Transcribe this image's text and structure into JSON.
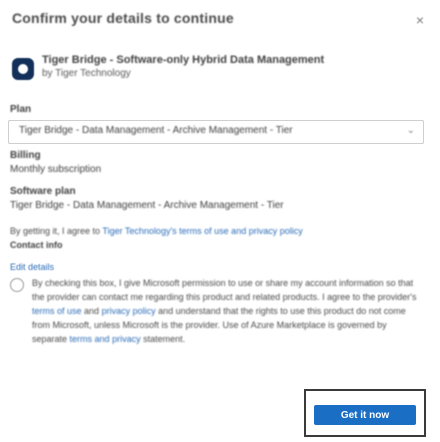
{
  "dialog": {
    "title": "Confirm your details to continue",
    "close_glyph": "×"
  },
  "product": {
    "icon": "app-logo-icon",
    "name": "Tiger Bridge - Software-only Hybrid Data Management",
    "description": "by Tiger Technology"
  },
  "plan": {
    "label": "Plan",
    "selected": "Tiger Bridge - Data Management - Archive Management - Tier"
  },
  "billing": {
    "label": "Billing",
    "value": "Monthly subscription"
  },
  "software_plan": {
    "label": "Software plan",
    "value": "Tiger Bridge - Data Management - Archive Management - Tier"
  },
  "terms": {
    "prefix": "By getting it, I agree to",
    "link": "Tiger Technology's terms of use and privacy policy",
    "sub_label": "Contact info",
    "edit_link": "Edit details"
  },
  "consent": {
    "text_main": "By checking this box, I give Microsoft permission to use or share my account information so that the provider can contact me regarding this product and related products. I agree to the provider's",
    "link_terms": "terms of use",
    "text_mid": "and",
    "link_privacy": "privacy policy",
    "text_tail": "and understand that the rights to use this product do not come from Microsoft, unless Microsoft is the provider. Use of Azure Marketplace is governed by separate",
    "link_tou": "terms and privacy",
    "text_end": "statement."
  },
  "actions": {
    "primary": "Get it now"
  },
  "colors": {
    "accent": "#1a6fc4",
    "link": "#2b6cb8",
    "icon_bg": "#13305a"
  }
}
